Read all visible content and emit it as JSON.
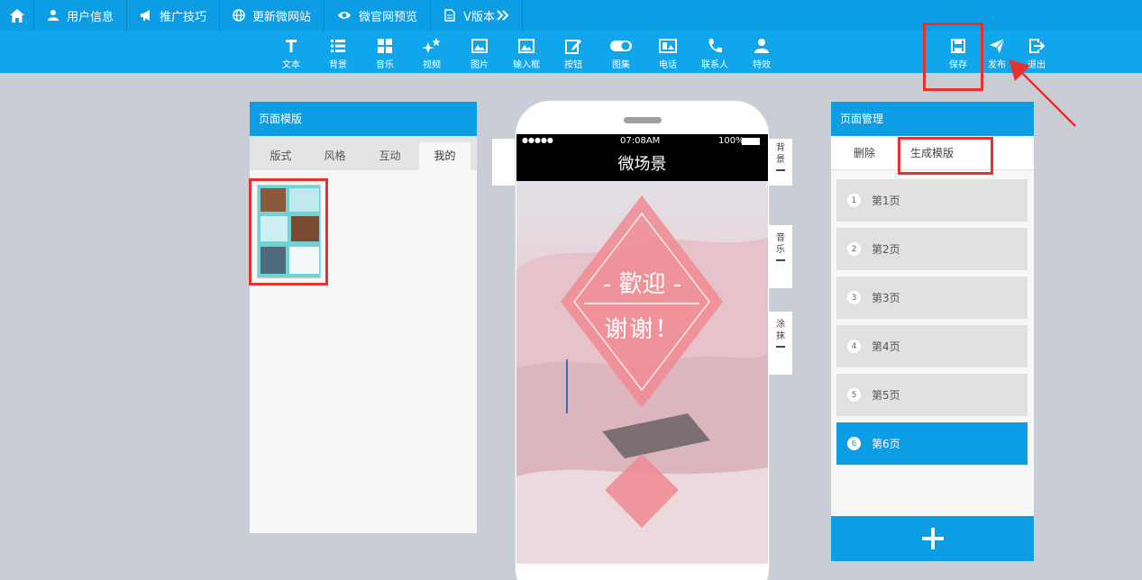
{
  "topnav": {
    "items": [
      {
        "label": "用户信息",
        "icon": "user-icon"
      },
      {
        "label": "推广技巧",
        "icon": "megaphone-icon"
      },
      {
        "label": "更新微网站",
        "icon": "globe-icon"
      },
      {
        "label": "微官网预览",
        "icon": "eye-icon"
      },
      {
        "label": "V版本",
        "icon": "document-icon"
      }
    ]
  },
  "toolbar": {
    "tools": [
      "文本",
      "背景",
      "音乐",
      "视频",
      "图片",
      "输入框",
      "按钮",
      "图集",
      "电话",
      "联系人",
      "特效"
    ],
    "actions": [
      "保存",
      "发布",
      "退出"
    ]
  },
  "left_panel": {
    "title": "页面模版",
    "tabs": [
      "版式",
      "风格",
      "互动",
      "我的"
    ],
    "active_tab": "我的"
  },
  "phone": {
    "signal": "●●●●●",
    "time": "07:08AM",
    "battery": "100%",
    "title": "微场景",
    "welcome": "- 歡迎 -",
    "thanks": "谢谢！"
  },
  "side_labels": [
    {
      "text": "背景"
    },
    {
      "text": "音乐"
    },
    {
      "text": "涂抹"
    }
  ],
  "right_panel": {
    "title": "页面管理",
    "delete_label": "删除",
    "template_label": "生成模版",
    "pages": [
      {
        "num": "1",
        "label": "第1页"
      },
      {
        "num": "2",
        "label": "第2页"
      },
      {
        "num": "3",
        "label": "第3页"
      },
      {
        "num": "4",
        "label": "第4页"
      },
      {
        "num": "5",
        "label": "第5页"
      },
      {
        "num": "6",
        "label": "第6页"
      }
    ],
    "active_page": "第6页"
  },
  "colors": {
    "primary": "#0d9de4",
    "highlight": "#e6322e"
  }
}
